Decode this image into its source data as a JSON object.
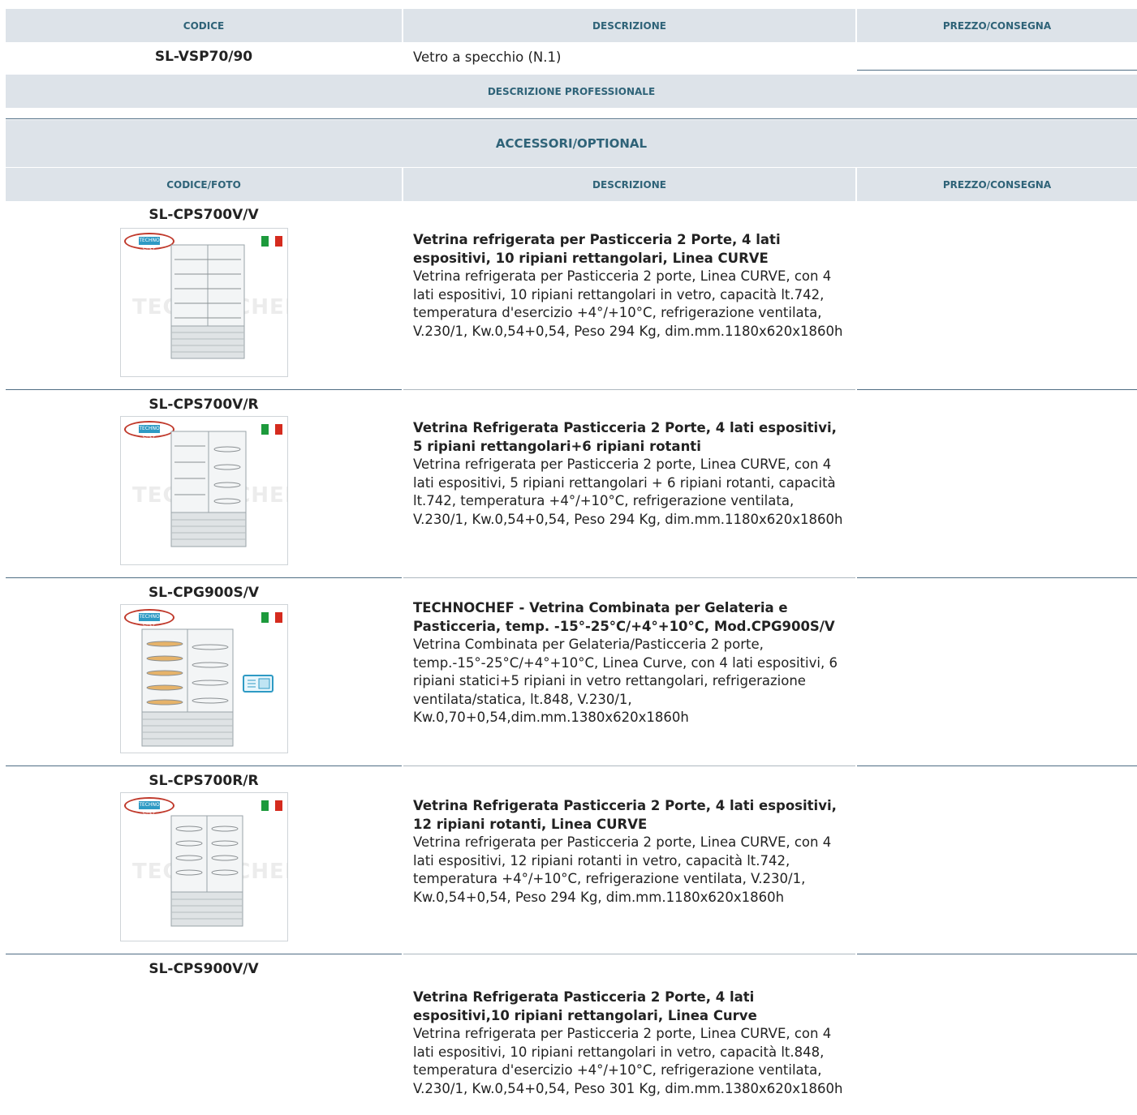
{
  "top_table": {
    "headers": {
      "code": "CODICE",
      "description": "DESCRIZIONE",
      "price": "PREZZO/CONSEGNA"
    },
    "row": {
      "code": "SL-VSP70/90",
      "description": "Vetro a specchio (N.1)",
      "price": ""
    },
    "professional_label": "DESCRIZIONE PROFESSIONALE"
  },
  "accessories": {
    "title": "ACCESSORI/OPTIONAL",
    "headers": {
      "code": "CODICE/FOTO",
      "description": "DESCRIZIONE",
      "price": "PREZZO/CONSEGNA"
    },
    "items": [
      {
        "code": "SL-CPS700V/V",
        "title": "Vetrina refrigerata per Pasticceria 2 Porte, 4 lati espositivi, 10 ripiani rettangolari, Linea CURVE",
        "text": "Vetrina refrigerata per Pasticceria 2 porte, Linea CURVE, con 4 lati espositivi, 10 ripiani rettangolari in vetro, capacità lt.742, temperatura d'esercizio +4°/+10°C, refrigerazione ventilata, V.230/1, Kw.0,54+0,54, Peso 294 Kg, dim.mm.1180x620x1860h"
      },
      {
        "code": "SL-CPS700V/R",
        "title": "Vetrina Refrigerata Pasticceria 2 Porte, 4 lati espositivi, 5 ripiani rettangolari+6 ripiani rotanti",
        "text": "Vetrina refrigerata per Pasticceria 2 porte, Linea CURVE, con 4 lati espositivi, 5 ripiani rettangolari + 6 ripiani rotanti, capacità lt.742, temperatura +4°/+10°C, refrigerazione ventilata, V.230/1, Kw.0,54+0,54, Peso 294 Kg, dim.mm.1180x620x1860h"
      },
      {
        "code": "SL-CPG900S/V",
        "title": "TECHNOCHEF - Vetrina Combinata per Gelateria e Pasticceria, temp. -15°-25°C/+4°+10°C, Mod.CPG900S/V",
        "text": "Vetrina Combinata per Gelateria/Pasticceria 2 porte, temp.-15°-25°C/+4°+10°C, Linea Curve, con 4 lati espositivi, 6 ripiani statici+5 ripiani in vetro rettangolari, refrigerazione ventilata/statica, lt.848, V.230/1, Kw.0,70+0,54,dim.mm.1380x620x1860h"
      },
      {
        "code": "SL-CPS700R/R",
        "title": "Vetrina Refrigerata Pasticceria 2 Porte, 4 lati espositivi, 12 ripiani rotanti, Linea CURVE",
        "text": "Vetrina refrigerata per Pasticceria 2 porte, Linea CURVE, con 4 lati espositivi, 12 ripiani rotanti in vetro, capacità lt.742, temperatura +4°/+10°C, refrigerazione ventilata, V.230/1, Kw.0,54+0,54, Peso 294 Kg, dim.mm.1180x620x1860h"
      },
      {
        "code": "SL-CPS900V/V",
        "title": "Vetrina Refrigerata Pasticceria 2 Porte, 4 lati espositivi,10 ripiani rettangolari, Linea Curve",
        "text": "Vetrina refrigerata per Pasticceria 2 porte, Linea CURVE, con 4 lati espositivi, 10 ripiani rettangolari in vetro, capacità lt.848, temperatura d'esercizio +4°/+10°C, refrigerazione ventilata, V.230/1, Kw.0,54+0,54, Peso 301 Kg, dim.mm.1380x620x1860h"
      }
    ]
  },
  "logo_text": "TECHNO CHEF",
  "watermark": "TECHNOCHEF.IT",
  "colors": {
    "header_bg": "#dde3e9",
    "header_text": "#2f6378",
    "separator": "#4f6d84",
    "flag_green": "#1d9a3c",
    "flag_red": "#d52b1e"
  }
}
